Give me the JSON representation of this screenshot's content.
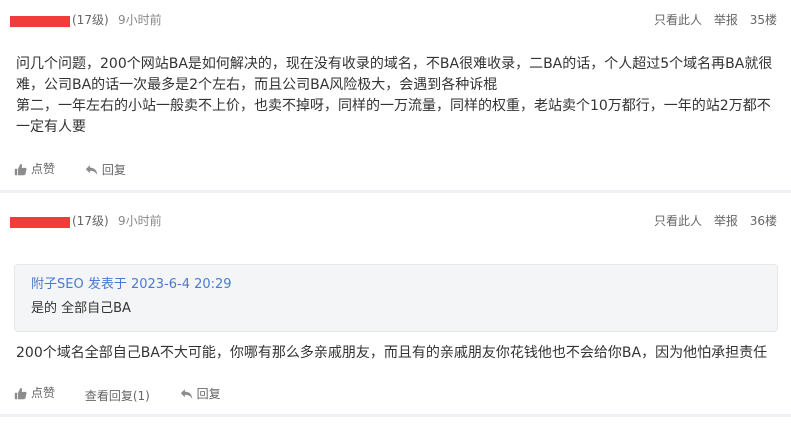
{
  "posts": [
    {
      "level": "(17级)",
      "time": "9小时前",
      "tools": {
        "only_author": "只看此人",
        "report": "举报",
        "floor": "35楼"
      },
      "content": "问几个问题，200个网站BA是如何解决的，现在没有收录的域名，不BA很难收录，二BA的话，个人超过5个域名再BA就很难，公司BA的话一次最多是2个左右，而且公司BA风险极大，会遇到各种诉棍\n第二，一年左右的小站一般卖不上价，也卖不掉呀，同样的一万流量，同样的权重，老站卖个10万都行，一年的站2万都不一定有人要",
      "actions": {
        "like": "点赞",
        "reply": "回复"
      }
    },
    {
      "level": "(17级)",
      "time": "9小时前",
      "tools": {
        "only_author": "只看此人",
        "report": "举报",
        "floor": "36楼"
      },
      "quote": {
        "header": "附子SEO 发表于 2023-6-4 20:29",
        "body": "是的 全部自己BA"
      },
      "content": "200个域名全部自己BA不大可能，你哪有那么多亲戚朋友，而且有的亲戚朋友你花钱他也不会给你BA，因为他怕承担责任",
      "actions": {
        "like": "点赞",
        "view_replies": "查看回复(1)",
        "reply": "回复"
      }
    }
  ],
  "colors": {
    "redaction": "#f23c3c",
    "quote_link": "#4a7ad0",
    "divider": "#eef0f3"
  }
}
